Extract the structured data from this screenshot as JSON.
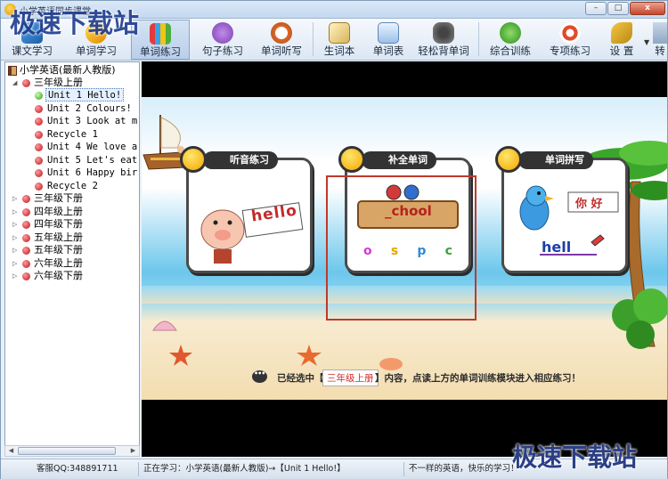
{
  "window": {
    "title": "小学英语同步课堂",
    "buttons": {
      "minimize": "–",
      "maximize": "□",
      "close": "x"
    }
  },
  "toolbar": {
    "items": [
      {
        "label": "课文学习",
        "icon": "textbook-icon"
      },
      {
        "label": "单词学习",
        "icon": "word-study-icon"
      },
      {
        "label": "单词练习",
        "icon": "crayons-icon",
        "active": true
      },
      {
        "label": "句子练习",
        "icon": "microphone-icon"
      },
      {
        "label": "单词听写",
        "icon": "clock-icon"
      },
      {
        "label": "生词本",
        "icon": "notebook-icon"
      },
      {
        "label": "单词表",
        "icon": "word-list-icon"
      },
      {
        "label": "轻松背单词",
        "icon": "glasses-icon"
      },
      {
        "label": "综合训练",
        "icon": "people-icon"
      },
      {
        "label": "专项练习",
        "icon": "target-icon"
      },
      {
        "label": "设 置",
        "icon": "wrench-icon"
      },
      {
        "label": "转",
        "icon": "more-icon"
      }
    ]
  },
  "tree": {
    "root": "小学英语(最新人教版)",
    "grades": [
      {
        "label": "三年级上册",
        "expanded": true,
        "units": [
          {
            "label": "Unit 1 Hello!",
            "selected": true
          },
          {
            "label": "Unit 2 Colours!"
          },
          {
            "label": "Unit 3 Look at m"
          },
          {
            "label": "Recycle 1"
          },
          {
            "label": "Unit 4 We love a"
          },
          {
            "label": "Unit 5 Let's eat"
          },
          {
            "label": "Unit 6 Happy bir"
          },
          {
            "label": "Recycle 2"
          }
        ]
      },
      {
        "label": "三年级下册"
      },
      {
        "label": "四年级上册"
      },
      {
        "label": "四年级下册"
      },
      {
        "label": "五年级上册"
      },
      {
        "label": "五年级下册"
      },
      {
        "label": "六年级上册"
      },
      {
        "label": "六年级下册"
      }
    ]
  },
  "stage": {
    "cards": [
      {
        "title": "听音练习",
        "image_text": "hello",
        "icon": "pig-listening-icon"
      },
      {
        "title": "补全单词",
        "image_text": "_chool",
        "letters": [
          "o",
          "s",
          "p",
          "c"
        ],
        "icon": "word-sign-icon"
      },
      {
        "title": "单词拼写",
        "image_text_cn": "你 好",
        "image_text_en": "hell",
        "icon": "bird-spelling-icon"
      }
    ],
    "info_prefix": "已经选中【",
    "info_grade": "三年级上册",
    "info_suffix": "】内容，点读上方的单词训练模块进入相应练习！"
  },
  "status": {
    "qq": "客服QQ:348891711",
    "learning": "正在学习：小学英语(最新人教版)→【Unit 1 Hello!】",
    "slogan": "不一样的英语，快乐的学习！"
  },
  "watermark": {
    "top": "极速下载站",
    "bottom": "极速下载站"
  },
  "colors": {
    "accent": "#3d76c6",
    "badge": "#f3a500",
    "highlight": "#c0392b",
    "tree_dot": "#b8131b"
  }
}
